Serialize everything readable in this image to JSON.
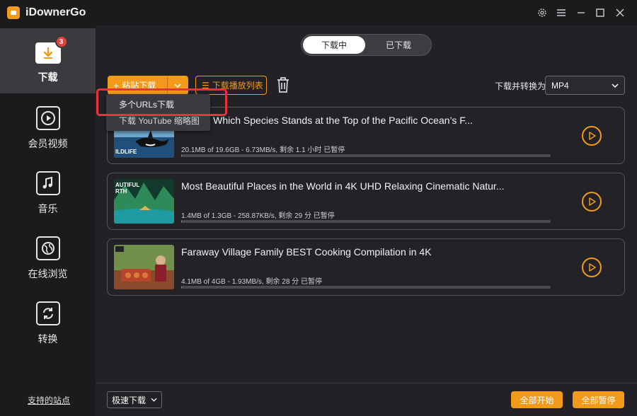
{
  "app": {
    "title": "iDownerGo"
  },
  "window_controls": [
    "gear-icon",
    "menu-icon",
    "minimize-icon",
    "maximize-icon",
    "close-icon"
  ],
  "sidebar": {
    "items": [
      {
        "label": "下载",
        "icon": "download-icon",
        "badge": "3",
        "active": true
      },
      {
        "label": "会员视频",
        "icon": "play-circle-icon"
      },
      {
        "label": "音乐",
        "icon": "music-icon"
      },
      {
        "label": "在线浏览",
        "icon": "globe-icon"
      },
      {
        "label": "转换",
        "icon": "convert-icon"
      }
    ],
    "supported_sites": "支持的站点"
  },
  "tabs": {
    "downloading": "下载中",
    "downloaded": "已下载",
    "active": "downloading"
  },
  "toolbar": {
    "paste_label": "粘贴下载",
    "playlist_label": "下载播放列表",
    "convert_label": "下载并转换为",
    "format_value": "MP4"
  },
  "dropdown": {
    "items": [
      "多个URLs下载",
      "下载 YouTube 缩略图"
    ]
  },
  "downloads": [
    {
      "title": "Ocean Which Species Stands at the Top of the Pacific Ocean’s F...",
      "status": "20.1MB of 19.6GB -   6.73MB/s, 剩余 1.1 小时 已暂停",
      "thumb_text": "ILDLIFE",
      "progress": 0.001
    },
    {
      "title": "Most Beautiful Places in the World in 4K UHD Relaxing Cinematic Natur...",
      "status": "1.4MB of 1.3GB -   258.87KB/s, 剩余 29 分 已暂停",
      "thumb_text": "AUTIFUL RTH",
      "progress": 0.001
    },
    {
      "title": "Faraway Village Family BEST Cooking Compilation in 4K",
      "status": "4.1MB of 4GB -   1.93MB/s, 剩余 28 分 已暂停",
      "thumb_text": "",
      "progress": 0.001
    }
  ],
  "bottom": {
    "speed_value": "极速下载",
    "start_all": "全部开始",
    "pause_all": "全部暂停"
  },
  "colors": {
    "accent": "#f39a1a",
    "highlight": "#e8323c",
    "badge": "#e8403a"
  }
}
